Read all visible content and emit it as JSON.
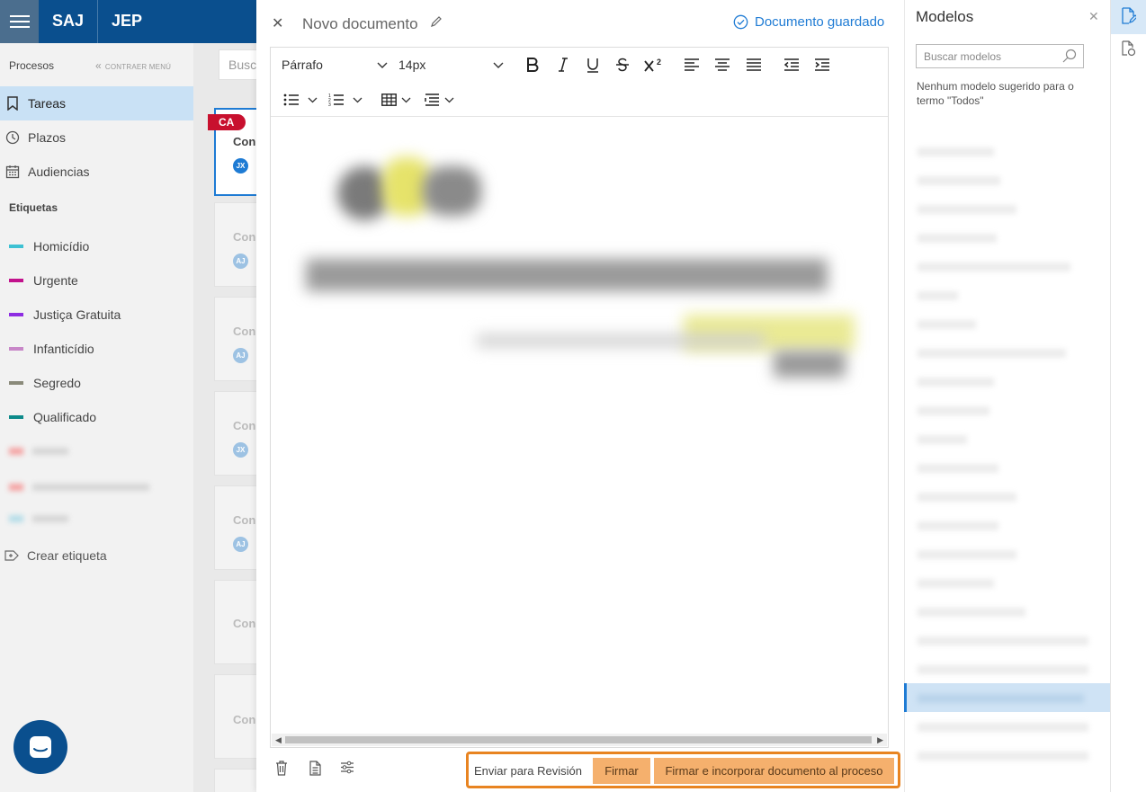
{
  "header": {
    "brand_primary": "SAJ",
    "brand_secondary": "JEP"
  },
  "sidebar": {
    "section_label": "Procesos",
    "collapse_label": "CONTRAER MENÚ",
    "nav": [
      {
        "label": "Tareas",
        "icon": "bookmark-icon"
      },
      {
        "label": "Plazos",
        "icon": "clock-icon"
      },
      {
        "label": "Audiencias",
        "icon": "calendar-icon"
      }
    ],
    "tags_label": "Etiquetas",
    "tags": [
      {
        "label": "Homicídio",
        "color": "#3ec1d3"
      },
      {
        "label": "Urgente",
        "color": "#c2128c"
      },
      {
        "label": "Justiça Gratuita",
        "color": "#8e2de2"
      },
      {
        "label": "Infanticídio",
        "color": "#c887c8"
      },
      {
        "label": "Segredo",
        "color": "#8a8a7a"
      },
      {
        "label": "Qualificado",
        "color": "#0d8a8a"
      }
    ],
    "create_tag_label": "Crear etiqueta"
  },
  "list": {
    "search_placeholder": "Busc",
    "badge": "CA",
    "cards": [
      {
        "title": "Con",
        "avatar": "JX"
      },
      {
        "title": "Con",
        "avatar": "AJ"
      },
      {
        "title": "Con",
        "avatar": "AJ"
      },
      {
        "title": "Con",
        "avatar": "JX"
      },
      {
        "title": "Con",
        "avatar": "AJ"
      },
      {
        "title": "Con",
        "avatar": ""
      },
      {
        "title": "Con",
        "avatar": ""
      }
    ]
  },
  "editor": {
    "title": "Novo documento",
    "saved_status": "Documento guardado",
    "paragraph_select": "Párrafo",
    "font_size_select": "14px",
    "actions": {
      "send_review": "Enviar para Revisión",
      "sign": "Firmar",
      "sign_incorporate": "Firmar e incorporar documento al proceso"
    }
  },
  "models": {
    "title": "Modelos",
    "search_placeholder": "Buscar modelos",
    "empty_note": "Nenhum modelo sugerido para o termo \"Todos\""
  },
  "colors": {
    "brand": "#0a4f8e",
    "accent": "#1e7bd4",
    "action": "#f5b06d",
    "highlight_frame": "#e88421"
  }
}
